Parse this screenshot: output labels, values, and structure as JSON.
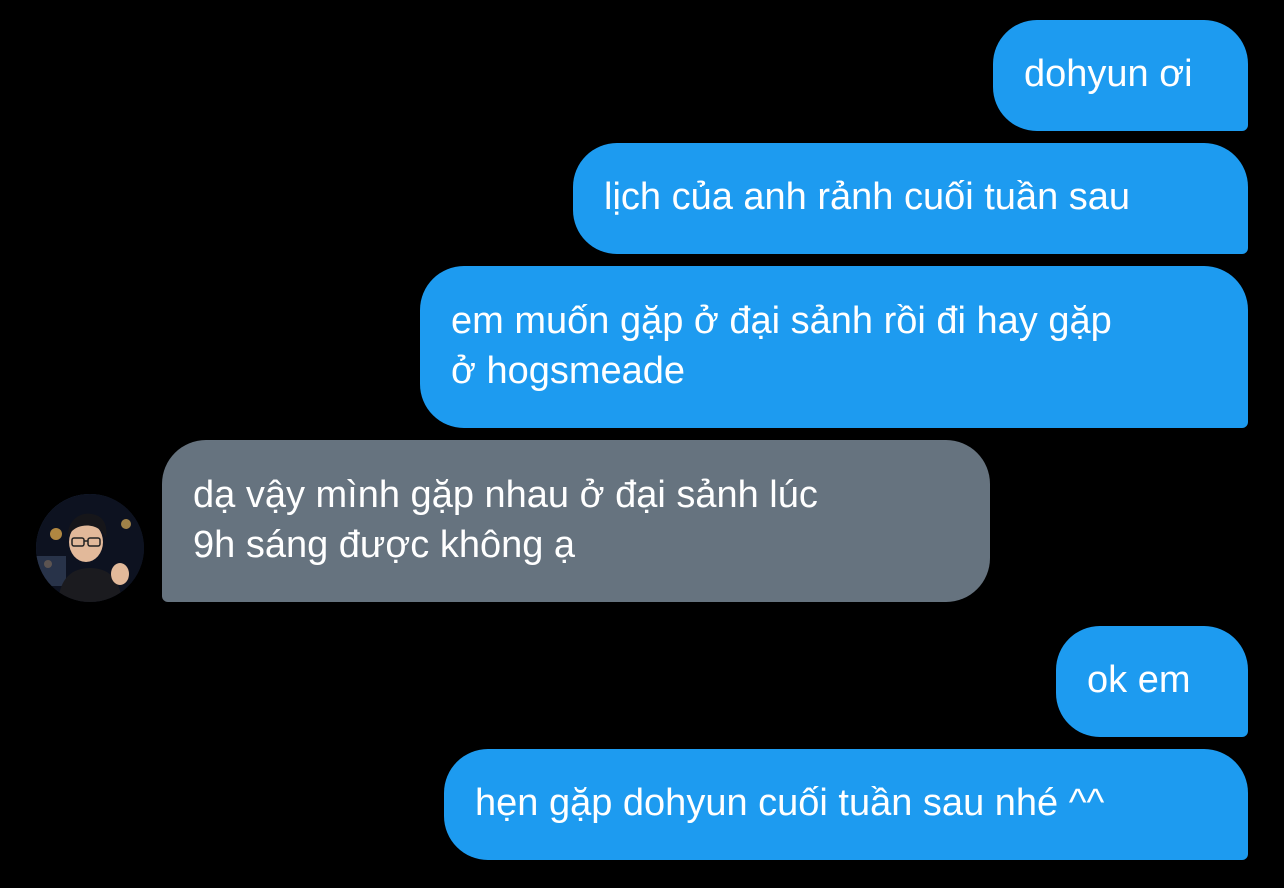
{
  "conversation": {
    "messages": [
      {
        "sender": "me",
        "text": "dohyun ơi"
      },
      {
        "sender": "me",
        "text": "lịch của anh rảnh cuối tuần sau"
      },
      {
        "sender": "me",
        "text": "em muốn gặp ở đại sảnh rồi đi hay gặp\nở hogsmeade"
      },
      {
        "sender": "dohyun",
        "text": "dạ vậy mình gặp nhau ở đại sảnh lúc\n9h sáng được không ạ"
      },
      {
        "sender": "me",
        "text": "ok em"
      },
      {
        "sender": "me",
        "text": "hẹn gặp dohyun cuối tuần sau nhé ^^"
      }
    ]
  },
  "colors": {
    "background": "#000000",
    "sent_bubble": "#1d9bf0",
    "received_bubble": "#66737f",
    "bubble_text": "#ffffff"
  },
  "icons": {
    "contact_avatar": "avatar-photo"
  }
}
